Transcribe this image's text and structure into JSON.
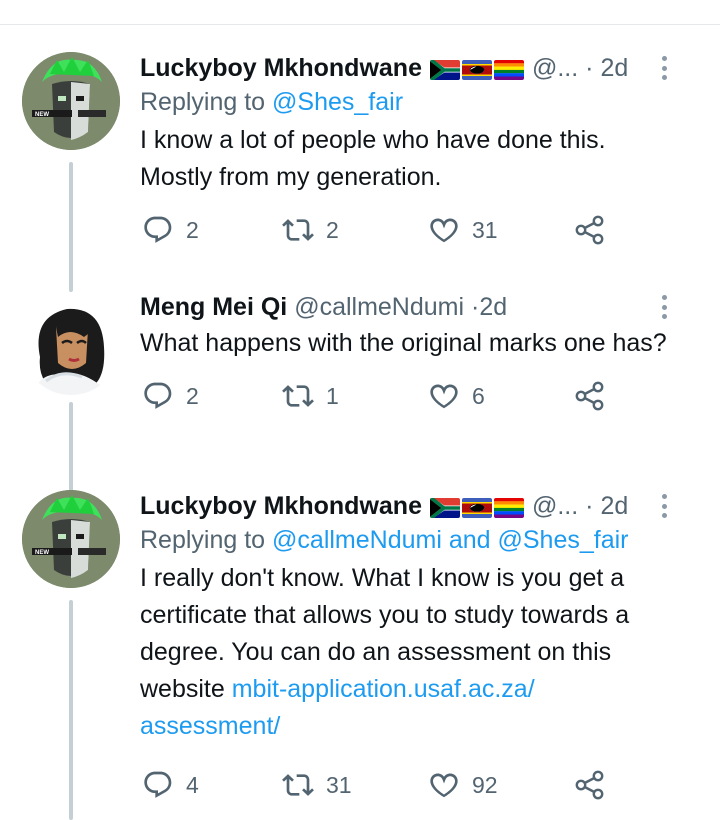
{
  "tweets": [
    {
      "name": "Luckyboy Mkhondwane",
      "flags": [
        "south-africa-flag",
        "eswatini-flag",
        "rainbow-flag"
      ],
      "handle": "@...",
      "dot": "·",
      "time": "2d",
      "reply_prefix": "Replying to",
      "reply_to": "@Shes_fair",
      "text": "I know a lot of people who have done this. Mostly from my generation.",
      "replies": "2",
      "retweets": "2",
      "likes": "31"
    },
    {
      "name": "Meng Mei Qi",
      "handle": "@callmeNdumi",
      "dot": "·",
      "time": "2d",
      "text": "What happens with the original marks one has?",
      "replies": "2",
      "retweets": "1",
      "likes": "6"
    },
    {
      "name": "Luckyboy Mkhondwane",
      "flags": [
        "south-africa-flag",
        "eswatini-flag",
        "rainbow-flag"
      ],
      "handle": "@...",
      "dot": "·",
      "time": "2d",
      "reply_prefix": "Replying to",
      "reply_to": "@callmeNdumi and @Shes_fair",
      "text": "I really don't know. What I know is you get a certificate that allows you to study towards a degree. You can do an assessment on this website",
      "link_line1": "mbit-application.usaf.ac.za/",
      "link_line2": "assessment/",
      "replies": "4",
      "retweets": "31",
      "likes": "92"
    }
  ],
  "colors": {
    "text": "#0f1419",
    "secondary": "#536471",
    "link": "#1d9bf0",
    "thread_line": "#c4cfd6"
  }
}
